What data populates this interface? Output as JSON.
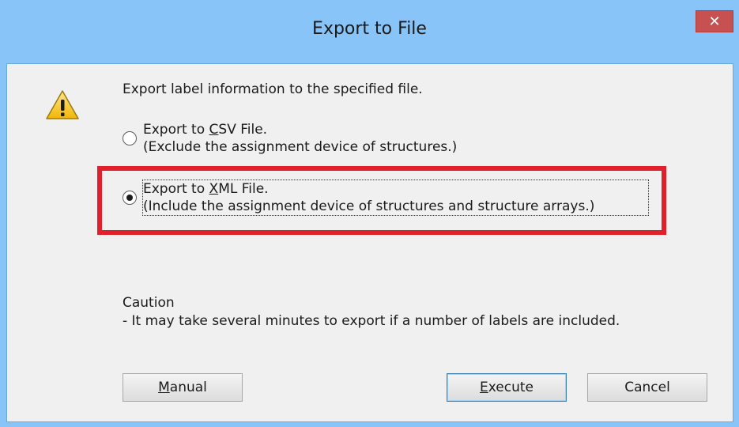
{
  "window": {
    "title": "Export to File",
    "close_label": "✕"
  },
  "message": "Export label information to the specified file.",
  "options": [
    {
      "access_key": "C",
      "label_before": "Export to ",
      "label_after": "SV File.",
      "description": "(Exclude the assignment device of structures.)",
      "selected": false
    },
    {
      "access_key": "X",
      "label_before": "Export to ",
      "label_after": "ML File.",
      "description": "(Include the assignment device of structures and structure arrays.)",
      "selected": true
    }
  ],
  "caution": {
    "heading": "Caution",
    "text": "- It may take several minutes to export if a number of labels are included."
  },
  "buttons": {
    "manual_key": "M",
    "manual_rest": "anual",
    "execute_key": "E",
    "execute_rest": "xecute",
    "cancel_label": "Cancel"
  },
  "colors": {
    "title_bar": "#88c4f7",
    "client_bg": "#f0f0f0",
    "highlight": "#e0202a",
    "close_button": "#c75050"
  },
  "icons": {
    "warning": "warning-icon",
    "close": "close-icon"
  }
}
